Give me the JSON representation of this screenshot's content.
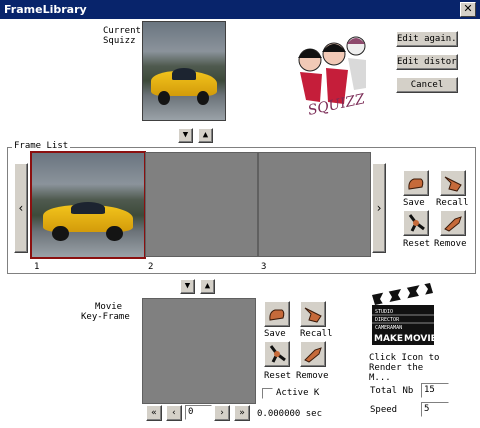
{
  "window": {
    "title": "FrameLibrary",
    "close_glyph": "✕"
  },
  "current": {
    "label_line1": "Current",
    "label_line2": "Squizz"
  },
  "logo_text": "SQUIZZ",
  "buttons": {
    "edit_again": "Edit again..",
    "edit_distort": "Edit distort..",
    "cancel": "Cancel"
  },
  "arrows": {
    "down": "▼",
    "up": "▲",
    "left": "‹",
    "right": "›"
  },
  "frame_list": {
    "legend": "Frame List",
    "frames": [
      {
        "number": "1"
      },
      {
        "number": "2"
      },
      {
        "number": "3"
      }
    ],
    "actions": {
      "save": "Save",
      "recall": "Recall",
      "reset": "Reset",
      "remove": "Remove"
    }
  },
  "movie": {
    "label_line1": "Movie",
    "label_line2": "Key-Frame",
    "actions": {
      "save": "Save",
      "recall": "Recall",
      "reset": "Reset",
      "remove": "Remove"
    },
    "active_k_label": "Active K",
    "nav": {
      "first": "«",
      "prev": "‹",
      "frame_value": "0",
      "next": "›",
      "last": "»"
    },
    "time_text": "0.000000 sec"
  },
  "render": {
    "clapper": {
      "studio": "STUDIO",
      "director": "DIRECTOR",
      "cameraman": "CAMERAMAN",
      "make": "MAKE",
      "movie": "MOVIE"
    },
    "hint_line1": "Click Icon to",
    "hint_line2": "Render the",
    "hint_line3": "M..."
  },
  "fields": {
    "total_label": "Total Nb",
    "total_value": "15",
    "speed_label": "Speed",
    "speed_value": "5"
  }
}
